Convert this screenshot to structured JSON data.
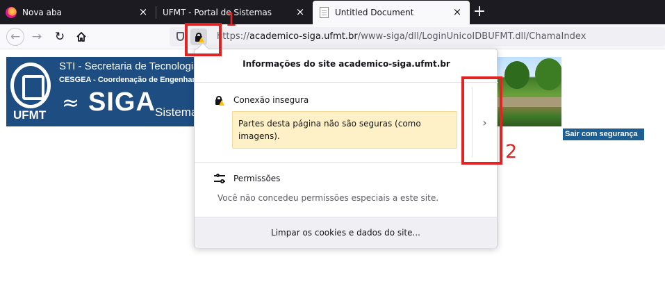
{
  "browser": {
    "tabs": [
      {
        "title": "Nova aba",
        "icon": "firefox-icon",
        "active": false
      },
      {
        "title": "UFMT - Portal de Sistemas",
        "icon": "none",
        "active": false
      },
      {
        "title": "Untitled Document",
        "icon": "document-icon",
        "active": true
      }
    ],
    "new_tab_symbol": "+",
    "close_symbol": "×",
    "url": {
      "prefix": "https://",
      "domain": "academico-siga.ufmt.br",
      "path": "/www-siga/dll/LoginUnicoIDBUFMT.dll/ChamaIndex"
    }
  },
  "banner": {
    "line1": "STI - Secretaria de Tecnologia d",
    "line2": "CESGEA - Coordenação de Engenharia",
    "ufmt_label": "UFMT",
    "siga_label": "SIGA",
    "sistema_label": "Sistema",
    "logout_label": "Sair com segurança"
  },
  "site_info_popup": {
    "header": "Informações do site academico-siga.ufmt.br",
    "connection": {
      "title": "Conexão insegura",
      "warning": "Partes desta página não são seguras (como imagens).",
      "expand_symbol": "›"
    },
    "permissions": {
      "title": "Permissões",
      "description": "Você não concedeu permissões especiais a este site."
    },
    "clear_button": "Limpar os cookies e dados do site..."
  },
  "annotations": [
    {
      "number": "1",
      "color": "#e02424"
    },
    {
      "number": "2",
      "color": "#e02424"
    }
  ],
  "colors": {
    "tabstrip": "#1c1b22",
    "banner_blue": "#1e4d82",
    "warning_bg": "#fff1c7",
    "annotation_red": "#e02424"
  }
}
